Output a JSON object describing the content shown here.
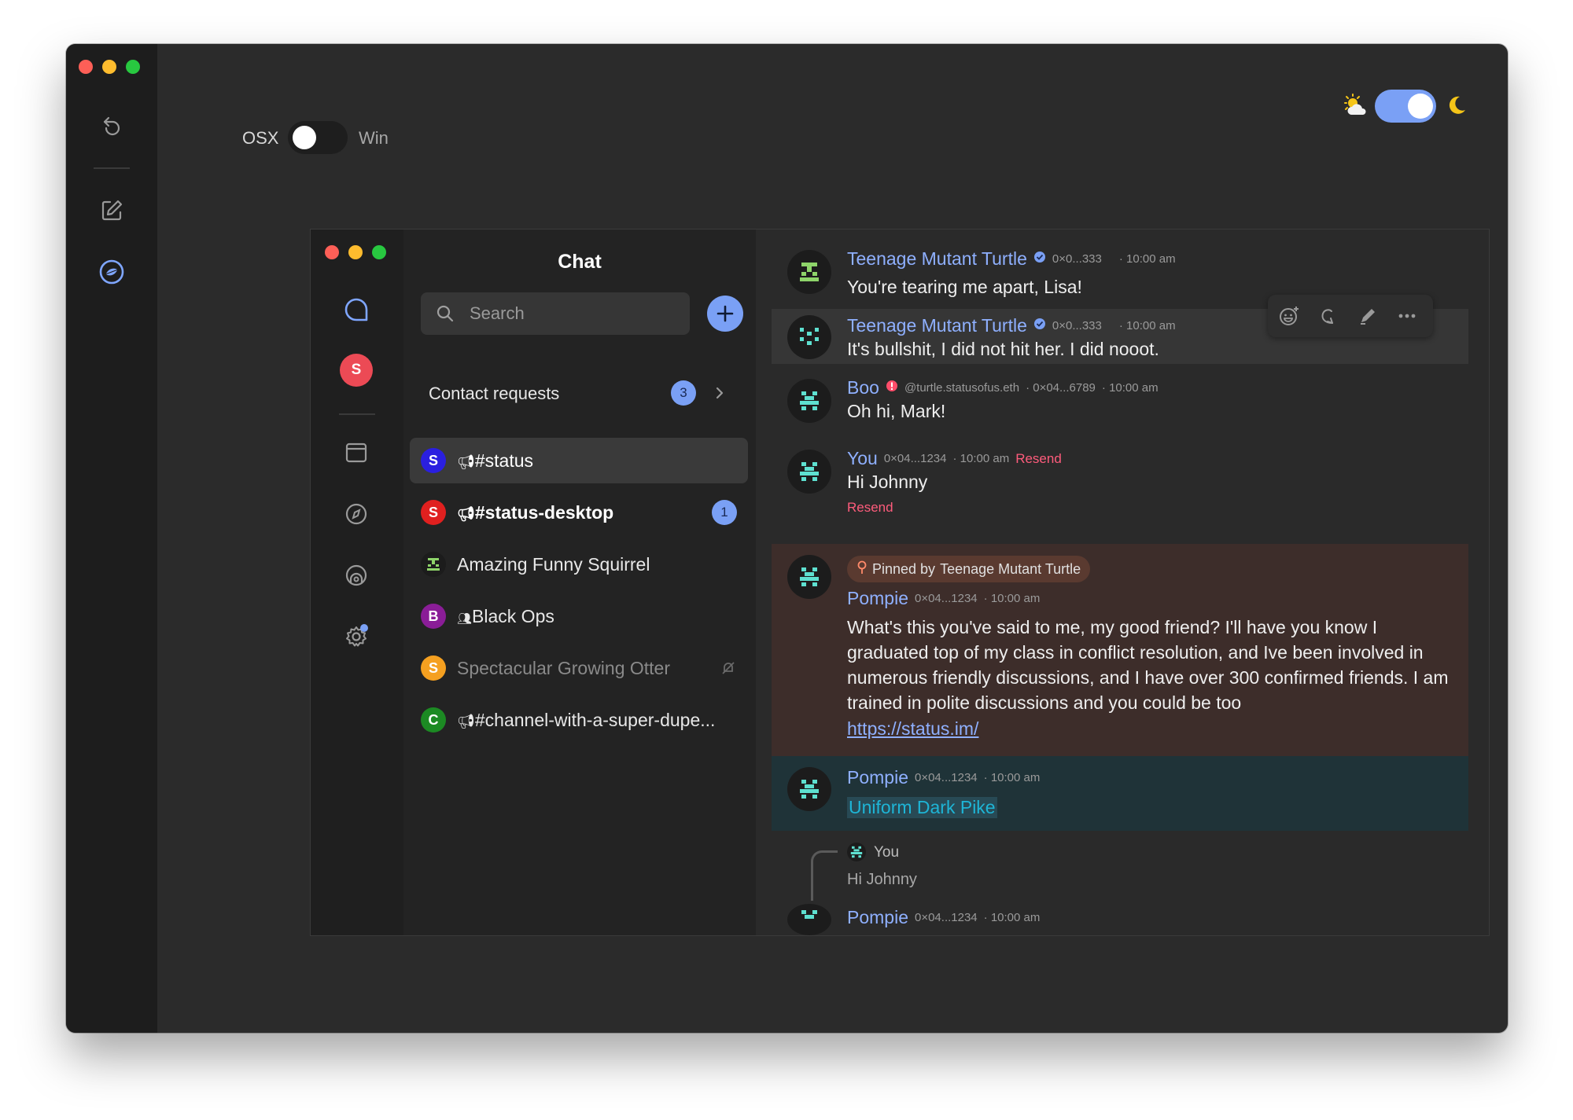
{
  "window": {
    "theme_toggle": {
      "state": "on",
      "sun_icon": "sun-cloud-icon",
      "moon_icon": "moon-icon"
    },
    "platform_toggle": {
      "left_label": "OSX",
      "right_label": "Win"
    }
  },
  "chat": {
    "title": "Chat",
    "search_placeholder": "Search",
    "contact_requests": {
      "label": "Contact requests",
      "count": "3"
    },
    "rail_avatar_letter": "S",
    "channels": [
      {
        "letter": "S",
        "name": "#status",
        "color": "#2a1fe0",
        "selected": true
      },
      {
        "letter": "S",
        "name": "#status-desktop",
        "color": "#e0201f",
        "unread": "1"
      },
      {
        "name": "Amazing Funny Squirrel"
      },
      {
        "letter": "B",
        "name": "Black Ops",
        "color": "#8a1d97"
      },
      {
        "letter": "S",
        "name": "Spectacular Growing Otter",
        "color": "#f5a020",
        "muted": true
      },
      {
        "letter": "C",
        "name": "#channel-with-a-super-dupe...",
        "color": "#1c8a23"
      }
    ]
  },
  "messages": [
    {
      "user": "Teenage Mutant Turtle",
      "address": "0×0...333",
      "time": "· 10:00 am",
      "text": "You're tearing me apart, Lisa!"
    },
    {
      "user": "Teenage Mutant Turtle",
      "address": "0×0...333",
      "time": "· 10:00 am",
      "text": "It's bullshit, I did not hit her. I did nooot."
    },
    {
      "user": "Boo",
      "ens": "@turtle.statusofus.eth",
      "address": "· 0×04...6789",
      "time": "· 10:00 am",
      "text": "Oh hi, Mark!"
    },
    {
      "user": "You",
      "address": "0×04...1234",
      "time": "· 10:00 am",
      "resend": "Resend",
      "text": "Hi Johnny",
      "resend_below": "Resend"
    },
    {
      "pinned_prefix": "Pinned by",
      "pinned_by": "Teenage Mutant Turtle",
      "user": "Pompie",
      "address": "0×04...1234",
      "time": "· 10:00 am",
      "text": "What's this you've said to me, my good friend? I'll have you know I graduated top of my class in conflict resolution, and Ive been involved in numerous friendly discussions, and I have over 300 confirmed friends. I am trained in polite discussions and you could be too",
      "link": "https://status.im/"
    },
    {
      "user": "Pompie",
      "address": "0×04...1234",
      "time": "· 10:00 am",
      "mention": "Uniform Dark Pike"
    },
    {
      "reply_user": "You",
      "reply_text": "Hi Johnny",
      "user": "Pompie",
      "address": "0×04...1234",
      "time": "· 10:00 am"
    }
  ],
  "colors": {
    "accent": "#8fb0ff",
    "resend": "#ff5c7c",
    "pinned_bg": "#3d2d2a",
    "mention_bg": "#1f3338",
    "mention_text": "#1eb5d6"
  }
}
